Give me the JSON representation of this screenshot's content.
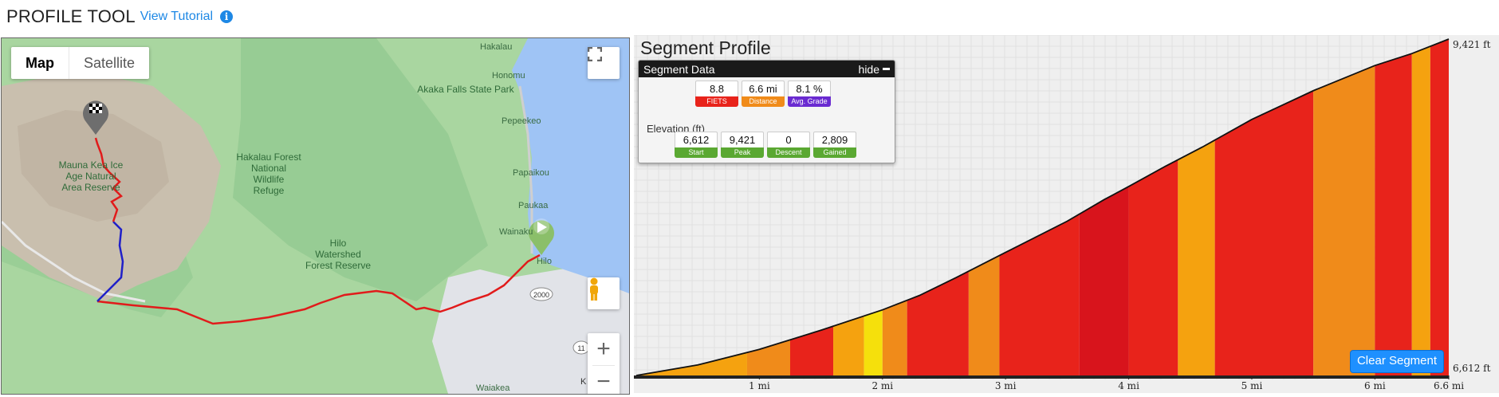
{
  "header": {
    "title": "PROFILE TOOL",
    "tutorial_link": "View Tutorial",
    "info_icon": "info-icon"
  },
  "map": {
    "type_buttons": [
      "Map",
      "Satellite"
    ],
    "active_type": "Map",
    "labels": {
      "hakalau": "Hakalau",
      "honomu": "Honomu",
      "akaka": "Akaka Falls State Park",
      "pepeekeo": "Pepeekeo",
      "papaikou": "Papaikou",
      "paukaa": "Paukaa",
      "wainaku": "Wainaku",
      "hilo": "Hilo",
      "hakalau_forest_1": "Hakalau Forest",
      "hakalau_forest_2": "National",
      "hakalau_forest_3": "Wildlife",
      "hakalau_forest_4": "Refuge",
      "maunakea_1": "Mauna Kea Ice",
      "maunakea_2": "Age Natural",
      "maunakea_3": "Area Reserve",
      "watershed_1": "Hilo",
      "watershed_2": "Watershed",
      "watershed_3": "Forest Reserve",
      "waiakea": "Waiakea",
      "route_2000": "2000",
      "route_11": "11",
      "k_fragment": "K"
    },
    "colors": {
      "land": "#a9d6a0",
      "land_dark": "#8cc58c",
      "ocean": "#9fc4f5",
      "mountain": "#c9bfae",
      "urban": "#e1e3e8",
      "route_red": "#e11b1b",
      "route_blue": "#2020c8"
    }
  },
  "profile": {
    "title": "Segment Profile",
    "segment_data": {
      "header": "Segment Data",
      "hide_label": "hide",
      "stats": [
        {
          "value": "8.8",
          "label": "FIETS",
          "color": "#e8231b"
        },
        {
          "value": "6.6 mi",
          "label": "Distance",
          "color": "#f08b1a"
        },
        {
          "value": "8.1 %",
          "label": "Avg. Grade",
          "color": "#6a2bd1"
        }
      ],
      "elevation_label": "Elevation (ft)",
      "elevation_stats": [
        {
          "value": "6,612",
          "label": "Start",
          "color": "#5aa832"
        },
        {
          "value": "9,421",
          "label": "Peak",
          "color": "#5aa832"
        },
        {
          "value": "0",
          "label": "Descent",
          "color": "#5aa832"
        },
        {
          "value": "2,809",
          "label": "Gained",
          "color": "#5aa832"
        }
      ]
    },
    "clear_button": "Clear Segment"
  },
  "chart_data": {
    "type": "area",
    "xlabel": "",
    "ylabel": "",
    "x_ticks": [
      "1 mi",
      "2 mi",
      "3 mi",
      "4 mi",
      "5 mi",
      "6 mi",
      "6.6 mi"
    ],
    "y_ticks": [
      "6,612 ft",
      "9,421 ft"
    ],
    "ylim": [
      6612,
      9421
    ],
    "xlim": [
      0,
      6.6
    ],
    "grid": true,
    "series": [
      {
        "x": [
          0,
          0.5,
          1.0,
          1.5,
          2.0,
          2.3,
          2.6,
          3.0,
          3.5,
          3.8,
          4.0,
          4.3,
          4.6,
          5.0,
          5.5,
          6.0,
          6.3,
          6.6
        ],
        "y": [
          6612,
          6700,
          6830,
          6990,
          7160,
          7280,
          7430,
          7640,
          7900,
          8080,
          8190,
          8360,
          8520,
          8750,
          8990,
          9200,
          9300,
          9421
        ]
      }
    ],
    "grade_bands": [
      {
        "x0": 0.0,
        "x1": 0.9,
        "color": "#f5a20f"
      },
      {
        "x0": 0.9,
        "x1": 1.25,
        "color": "#f08b1a"
      },
      {
        "x0": 1.25,
        "x1": 1.6,
        "color": "#e8231b"
      },
      {
        "x0": 1.6,
        "x1": 1.85,
        "color": "#f5a20f"
      },
      {
        "x0": 1.85,
        "x1": 2.0,
        "color": "#f5e00c"
      },
      {
        "x0": 2.0,
        "x1": 2.2,
        "color": "#f08b1a"
      },
      {
        "x0": 2.2,
        "x1": 2.7,
        "color": "#e8231b"
      },
      {
        "x0": 2.7,
        "x1": 2.95,
        "color": "#f08b1a"
      },
      {
        "x0": 2.95,
        "x1": 3.6,
        "color": "#e8231b"
      },
      {
        "x0": 3.6,
        "x1": 4.0,
        "color": "#d8141c"
      },
      {
        "x0": 4.0,
        "x1": 4.4,
        "color": "#e8231b"
      },
      {
        "x0": 4.4,
        "x1": 4.7,
        "color": "#f5a20f"
      },
      {
        "x0": 4.7,
        "x1": 5.5,
        "color": "#e8231b"
      },
      {
        "x0": 5.5,
        "x1": 6.0,
        "color": "#f08b1a"
      },
      {
        "x0": 6.0,
        "x1": 6.3,
        "color": "#e8231b"
      },
      {
        "x0": 6.3,
        "x1": 6.45,
        "color": "#f5a20f"
      },
      {
        "x0": 6.45,
        "x1": 6.6,
        "color": "#e8231b"
      }
    ]
  }
}
